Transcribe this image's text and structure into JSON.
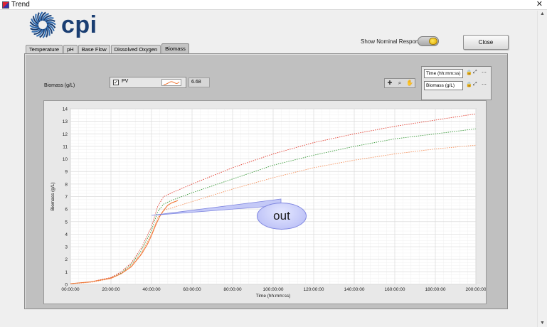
{
  "window": {
    "title": "Trend",
    "close_glyph": "✕"
  },
  "logo": {
    "text": "cpi"
  },
  "controls": {
    "show_nominal_label": "Show Nominal Responses",
    "close_label": "Close"
  },
  "tabs": [
    {
      "label": "Temperature",
      "active": false
    },
    {
      "label": "pH",
      "active": false
    },
    {
      "label": "Base Flow",
      "active": false
    },
    {
      "label": "Dissolved Oxygen",
      "active": false
    },
    {
      "label": "Biomass",
      "active": true
    }
  ],
  "graph": {
    "title_label": "Biomass (g/L)",
    "legend": {
      "name": "PV",
      "checked": true,
      "value": "6.68",
      "swatch_color": "#f07838"
    },
    "scales": [
      {
        "label": "Time (hh:mm:ss)"
      },
      {
        "label": "Biomass (g/L)"
      }
    ],
    "callout_text": "out"
  },
  "chart_data": {
    "type": "line",
    "xlabel": "Time (hh:mm:ss)",
    "ylabel": "Biomass (g/L)",
    "x_ticks": [
      "00:00:00",
      "20:00:00",
      "40:00:00",
      "60:00:00",
      "80:00:00",
      "100:00:00",
      "120:00:00",
      "140:00:00",
      "160:00:00",
      "180:00:00",
      "200:00:00"
    ],
    "xlim_hours": [
      0,
      200
    ],
    "ylim": [
      0,
      14
    ],
    "y_ticks": [
      0,
      1,
      2,
      3,
      4,
      5,
      6,
      7,
      8,
      9,
      10,
      11,
      12,
      13,
      14
    ],
    "grid": true,
    "series": [
      {
        "color": "#e23d2f",
        "style": "dotted",
        "x": [
          0,
          10,
          20,
          25,
          30,
          35,
          40,
          43,
          46,
          50,
          60,
          80,
          100,
          120,
          140,
          160,
          180,
          200
        ],
        "y": [
          0.05,
          0.2,
          0.55,
          1.0,
          1.7,
          2.9,
          4.6,
          6.2,
          7.0,
          7.3,
          8.0,
          9.3,
          10.4,
          11.3,
          12.0,
          12.6,
          13.1,
          13.6
        ]
      },
      {
        "color": "#3a9a3a",
        "style": "dotted",
        "x": [
          0,
          10,
          20,
          25,
          30,
          35,
          40,
          43,
          46,
          50,
          60,
          80,
          100,
          120,
          140,
          160,
          180,
          200
        ],
        "y": [
          0.05,
          0.18,
          0.5,
          0.9,
          1.6,
          2.7,
          4.3,
          5.8,
          6.4,
          6.7,
          7.3,
          8.4,
          9.5,
          10.3,
          11.0,
          11.6,
          12.0,
          12.4
        ]
      },
      {
        "color": "#f5905a",
        "style": "dotted",
        "x": [
          0,
          10,
          20,
          25,
          30,
          35,
          40,
          43,
          46,
          50,
          60,
          80,
          100,
          120,
          140,
          160,
          180,
          200
        ],
        "y": [
          0.05,
          0.16,
          0.45,
          0.85,
          1.5,
          2.5,
          4.0,
          5.3,
          5.9,
          6.1,
          6.6,
          7.6,
          8.5,
          9.3,
          9.9,
          10.4,
          10.8,
          11.1
        ]
      },
      {
        "name": "PV",
        "color": "#f07838",
        "style": "solid",
        "x": [
          0,
          10,
          20,
          25,
          30,
          35,
          38,
          40,
          42,
          44,
          46,
          48,
          50,
          53
        ],
        "y": [
          0.05,
          0.2,
          0.5,
          0.85,
          1.4,
          2.4,
          3.2,
          3.9,
          4.7,
          5.4,
          5.9,
          6.3,
          6.5,
          6.68
        ]
      }
    ]
  }
}
